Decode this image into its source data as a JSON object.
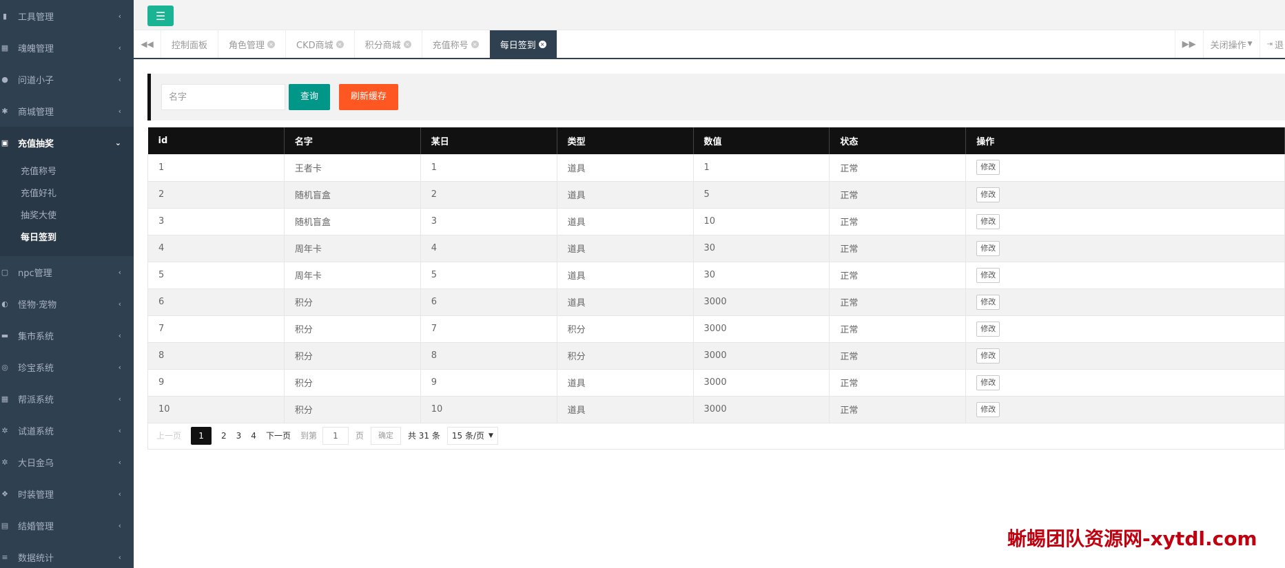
{
  "sidebar": {
    "items": [
      {
        "label": "工具管理",
        "icon": "chart-icon"
      },
      {
        "label": "魂魄管理",
        "icon": "grid-icon"
      },
      {
        "label": "问道小子",
        "icon": "user-icon"
      },
      {
        "label": "商城管理",
        "icon": "gear-icon"
      },
      {
        "label": "充值抽奖",
        "icon": "money-icon",
        "expanded": true,
        "children": [
          "充值称号",
          "充值好礼",
          "抽奖大使",
          "每日签到"
        ],
        "current": "每日签到"
      },
      {
        "label": "npc管理",
        "icon": "square-icon"
      },
      {
        "label": "怪物·宠物",
        "icon": "half-circle-icon"
      },
      {
        "label": "集市系统",
        "icon": "bed-icon"
      },
      {
        "label": "珍宝系统",
        "icon": "circle-icon"
      },
      {
        "label": "帮派系统",
        "icon": "grid-icon"
      },
      {
        "label": "试道系统",
        "icon": "gears-icon"
      },
      {
        "label": "大日金乌",
        "icon": "gears-icon"
      },
      {
        "label": "时装管理",
        "icon": "cubes-icon"
      },
      {
        "label": "结婚管理",
        "icon": "bookmark-icon"
      },
      {
        "label": "数据统计",
        "icon": "database-icon"
      }
    ]
  },
  "tabs": [
    "控制面板",
    "角色管理",
    "CKD商城",
    "积分商城",
    "充值称号",
    "每日签到"
  ],
  "active_tab": "每日签到",
  "tabs_right": {
    "close_ops": "关闭操作",
    "exit": "退"
  },
  "search": {
    "placeholder": "名字",
    "query_label": "查询",
    "refresh_label": "刷新缓存"
  },
  "table": {
    "headers": [
      "id",
      "名字",
      "某日",
      "类型",
      "数值",
      "状态",
      "操作"
    ],
    "rows": [
      [
        "1",
        "王者卡",
        "1",
        "道具",
        "1",
        "正常",
        "修改"
      ],
      [
        "2",
        "随机盲盒",
        "2",
        "道具",
        "5",
        "正常",
        "修改"
      ],
      [
        "3",
        "随机盲盒",
        "3",
        "道具",
        "10",
        "正常",
        "修改"
      ],
      [
        "4",
        "周年卡",
        "4",
        "道具",
        "30",
        "正常",
        "修改"
      ],
      [
        "5",
        "周年卡",
        "5",
        "道具",
        "30",
        "正常",
        "修改"
      ],
      [
        "6",
        "积分",
        "6",
        "道具",
        "3000",
        "正常",
        "修改"
      ],
      [
        "7",
        "积分",
        "7",
        "积分",
        "3000",
        "正常",
        "修改"
      ],
      [
        "8",
        "积分",
        "8",
        "积分",
        "3000",
        "正常",
        "修改"
      ],
      [
        "9",
        "积分",
        "9",
        "道具",
        "3000",
        "正常",
        "修改"
      ],
      [
        "10",
        "积分",
        "10",
        "道具",
        "3000",
        "正常",
        "修改"
      ]
    ]
  },
  "pager": {
    "prev": "上一页",
    "pages": [
      "1",
      "2",
      "3",
      "4"
    ],
    "current": "1",
    "next": "下一页",
    "goto": "到第",
    "goto_value": "1",
    "page_unit": "页",
    "ok": "确定",
    "total": "共 31 条",
    "per_page": "15 条/页"
  },
  "watermark": "蜥蜴团队资源网-xytdl.com"
}
